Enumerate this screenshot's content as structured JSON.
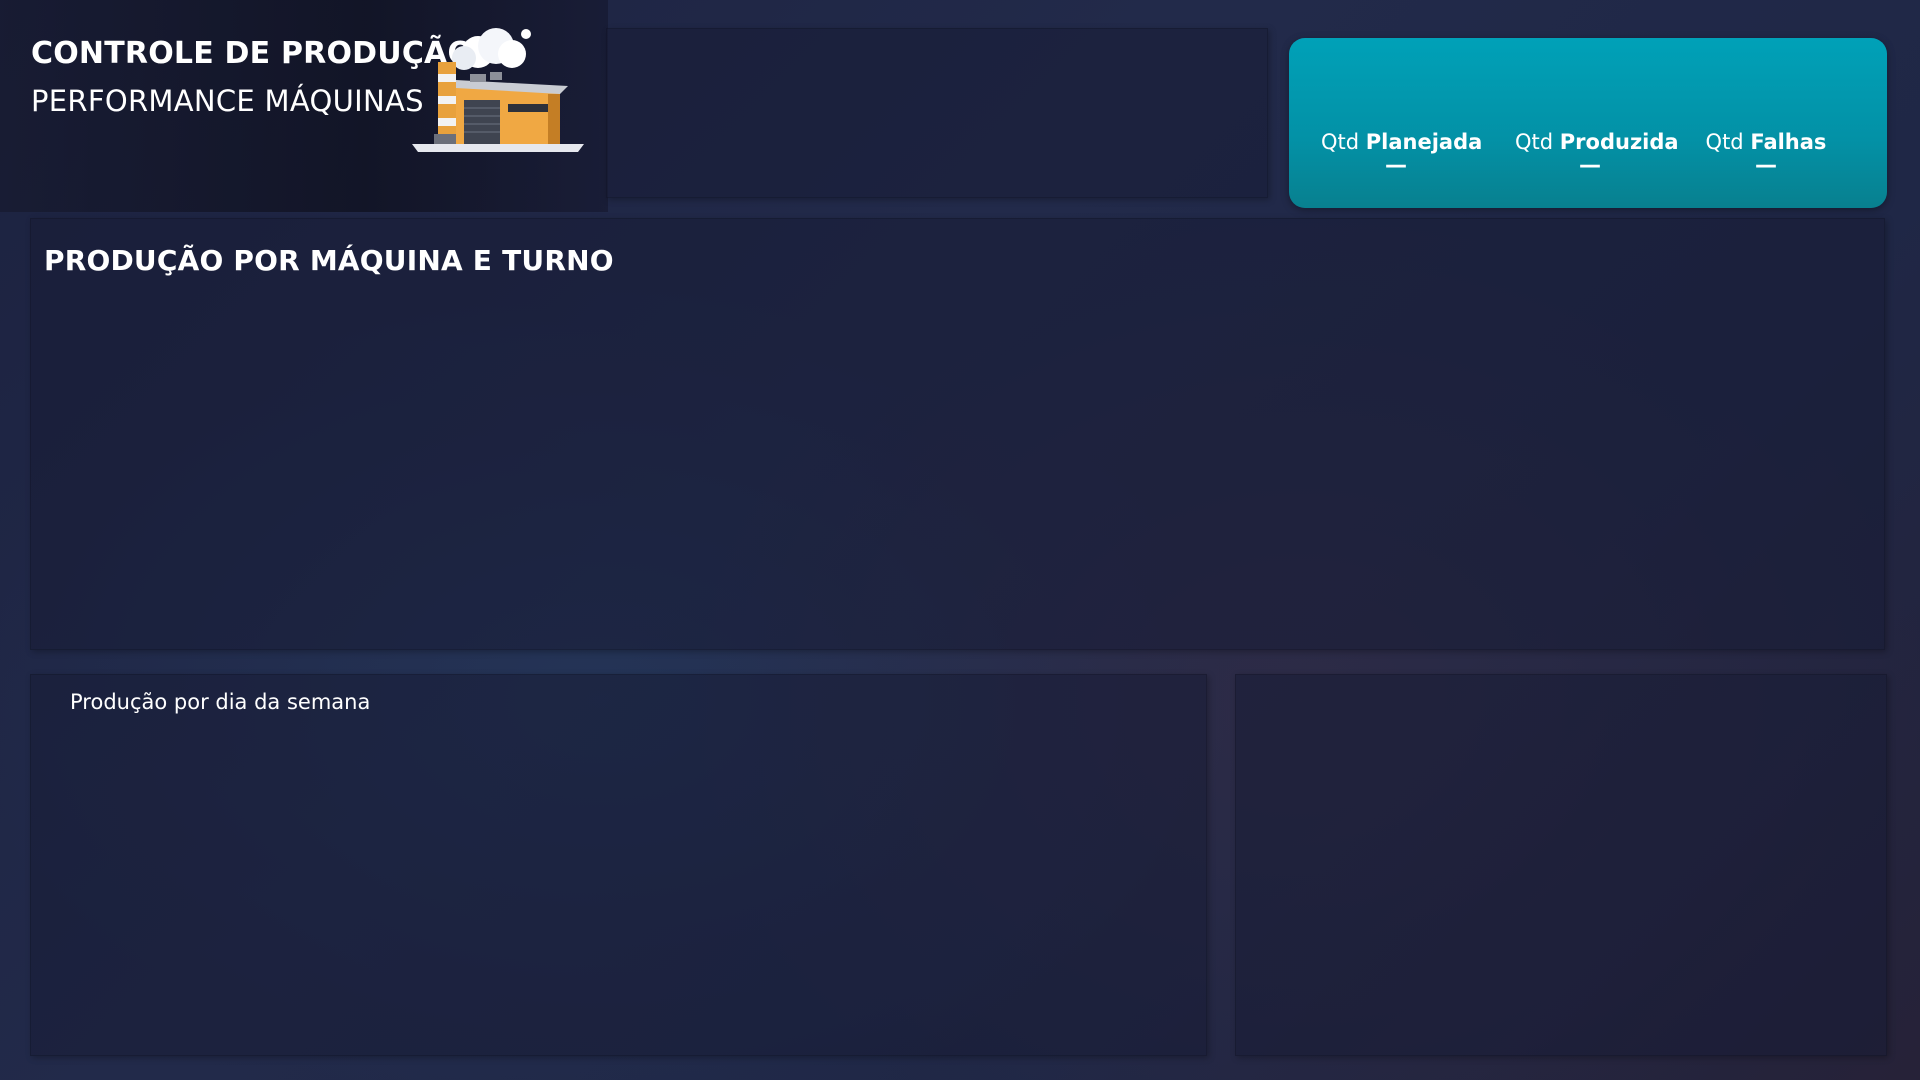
{
  "header": {
    "title": "CONTROLE DE PRODUÇÃO",
    "subtitle": "PERFORMANCE MÁQUINAS",
    "icon": "factory-icon"
  },
  "kpis": [
    {
      "prefix": "Qtd",
      "label": "Planejada",
      "value": "—"
    },
    {
      "prefix": "Qtd",
      "label": "Produzida",
      "value": "—"
    },
    {
      "prefix": "Qtd",
      "label": "Falhas",
      "value": "—"
    }
  ],
  "colors": {
    "kpi_card": "#00a1b8",
    "background": "#1f2746",
    "factory_orange": "#e8a13c"
  },
  "production_section": {
    "title": "PRODUÇÃO POR MÁQUINA E TURNO"
  },
  "weekday_section": {
    "caption": "Produção por dia da semana"
  }
}
